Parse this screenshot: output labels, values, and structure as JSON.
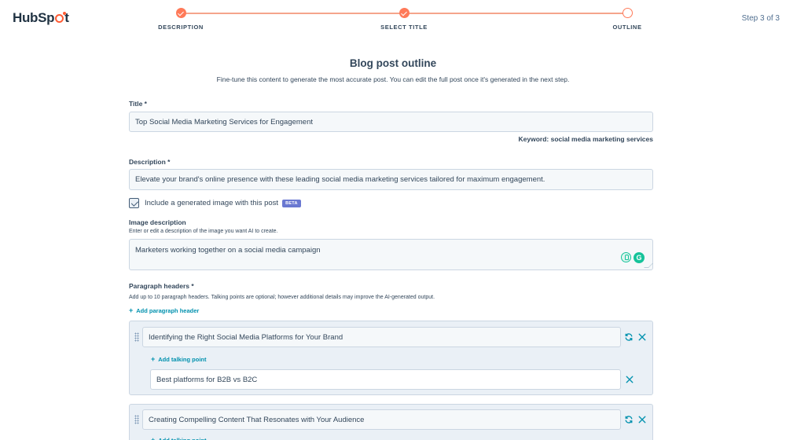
{
  "brand": {
    "logo_prefix": "HubSp",
    "logo_suffix": "t",
    "accent": "#ff7a59",
    "link_color": "#0091ae"
  },
  "stepper": {
    "counter": "Step 3 of 3",
    "steps": [
      {
        "label": "DESCRIPTION",
        "state": "done"
      },
      {
        "label": "SELECT TITLE",
        "state": "done"
      },
      {
        "label": "OUTLINE",
        "state": "current"
      }
    ]
  },
  "page": {
    "title": "Blog post outline",
    "subtitle": "Fine-tune this content to generate the most accurate post. You can edit the full post once it's generated in the next step."
  },
  "form": {
    "title_label": "Title *",
    "title_value": "Top Social Media Marketing Services for Engagement",
    "keyword": "Keyword: social media marketing services",
    "description_label": "Description *",
    "description_value": "Elevate your brand's online presence with these leading social media marketing services tailored for maximum engagement.",
    "include_image_label": "Include a generated image with this post",
    "beta_badge": "BETA",
    "image_label": "Image description",
    "image_help": "Enter or edit a description of the image you want AI to create.",
    "image_value": "Marketers working together on a social media campaign",
    "paragraph_label": "Paragraph headers *",
    "paragraph_help": "Add up to 10 paragraph headers. Talking points are optional; however additional details may improve the AI-generated output.",
    "add_header_label": "Add paragraph header",
    "add_talking_point_label": "Add talking point",
    "headers": [
      {
        "value": "Identifying the Right Social Media Platforms for Your Brand",
        "talking_points": [
          "Best platforms for B2B vs B2C"
        ]
      },
      {
        "value": "Creating Compelling Content That Resonates with Your Audience",
        "talking_points": []
      }
    ]
  }
}
